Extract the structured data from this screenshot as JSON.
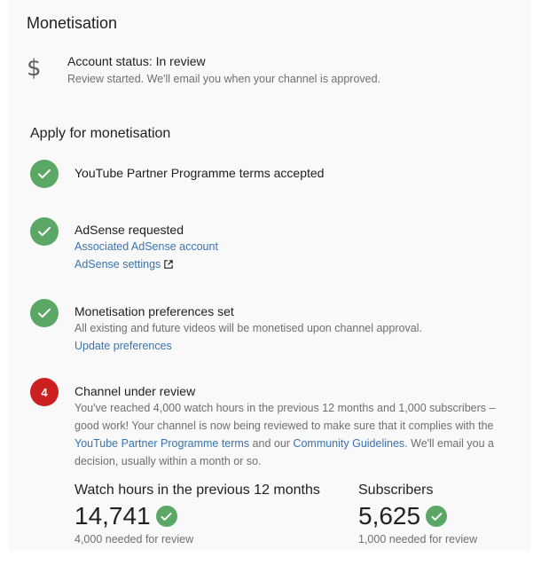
{
  "title": "Monetisation",
  "account": {
    "icon": "dollar-icon",
    "status": "Account status: In review",
    "subtext": "Review started. We'll email you when your channel is approved."
  },
  "apply": {
    "title": "Apply for monetisation",
    "steps": [
      {
        "icon": "check-icon",
        "heading": "YouTube Partner Programme terms accepted"
      },
      {
        "icon": "check-icon",
        "heading": "AdSense requested",
        "link1": "Associated AdSense account",
        "link2": "AdSense settings"
      },
      {
        "icon": "check-icon",
        "heading": "Monetisation preferences set",
        "desc": "All existing and future videos will be monetised upon channel approval.",
        "link": "Update preferences"
      },
      {
        "number": "4",
        "heading": "Channel under review",
        "desc_part1": "You've reached 4,000 watch hours in the previous 12 months and 1,000 subscribers – good work! Your channel is now being reviewed to make sure that it complies with the ",
        "link_terms": "YouTube Partner Programme terms",
        "desc_part2": " and our ",
        "link_guidelines": "Community Guidelines",
        "desc_part3": ". We'll email you a decision, usually within a month or so."
      }
    ]
  },
  "metrics": {
    "watch": {
      "label": "Watch hours in the previous 12 months",
      "value": "14,741",
      "note": "4,000 needed for review"
    },
    "subs": {
      "label": "Subscribers",
      "value": "5,625",
      "note": "1,000 needed for review"
    }
  },
  "colors": {
    "success": "#5ba866",
    "alert": "#cc1f1f",
    "link": "#3a73b0",
    "panel_bg": "#f9f9f9"
  }
}
